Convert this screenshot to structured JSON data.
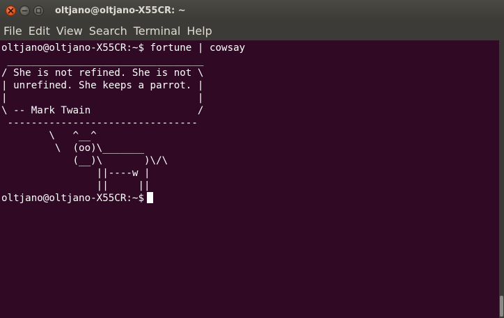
{
  "window": {
    "title": "oltjano@oltjano-X55CR: ~"
  },
  "menu": {
    "items": [
      "File",
      "Edit",
      "View",
      "Search",
      "Terminal",
      "Help"
    ]
  },
  "terminal": {
    "lines": [
      "oltjano@oltjano-X55CR:~$ fortune | cowsay",
      " _________________________________",
      "/ She is not refined. She is not \\",
      "| unrefined. She keeps a parrot. |",
      "|                                |",
      "\\ -- Mark Twain                  /",
      " --------------------------------",
      "        \\   ^__^",
      "         \\  (oo)\\_______",
      "            (__)\\       )\\/\\",
      "                ||----w |",
      "                ||     ||"
    ],
    "prompt": "oltjano@oltjano-X55CR:~$"
  },
  "colors": {
    "terminal_bg": "#300a24",
    "text": "#ffffff",
    "titlebar_bg": "#3c3b37",
    "close_button": "#e0531e"
  },
  "icons": {
    "close": "close-icon",
    "minimize": "minimize-icon",
    "maximize": "maximize-icon"
  }
}
